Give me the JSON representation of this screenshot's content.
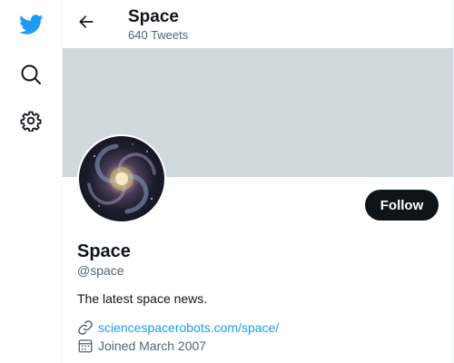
{
  "nav": {
    "items": [
      {
        "icon": "twitter-bird-icon",
        "color": "#1d9bf0"
      },
      {
        "icon": "search-icon"
      },
      {
        "icon": "gear-icon"
      }
    ]
  },
  "header": {
    "title": "Space",
    "subtitle": "640 Tweets",
    "back_icon": "back-arrow-icon"
  },
  "profile": {
    "banner_color": "#cfd9de",
    "avatar_description": "spiral-galaxy",
    "follow_label": "Follow",
    "display_name": "Space",
    "handle": "@space",
    "bio": "The latest space news.",
    "website": "sciencespacerobots.com/space/",
    "joined": "Joined March 2007"
  },
  "colors": {
    "accent": "#1d9bf0",
    "text_primary": "#0f1419",
    "text_secondary": "#536471",
    "button_bg": "#0f1419"
  }
}
